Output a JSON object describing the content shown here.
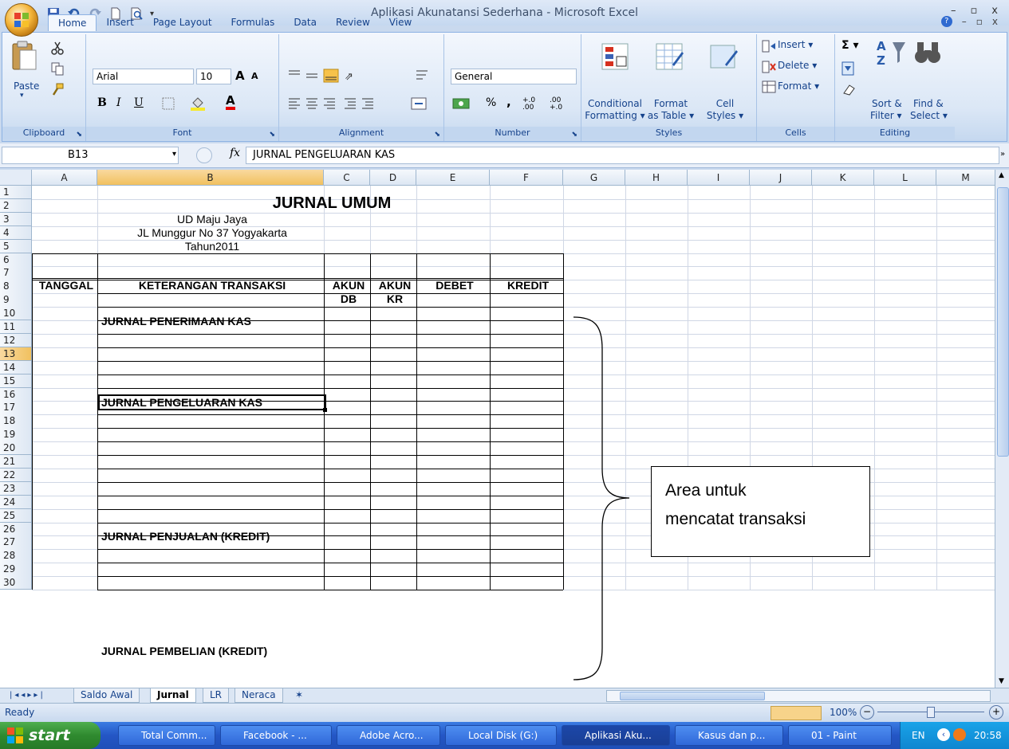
{
  "window": {
    "title": "Aplikasi Akunatansi Sederhana - Microsoft Excel"
  },
  "ribbon": {
    "tabs": [
      "Home",
      "Insert",
      "Page Layout",
      "Formulas",
      "Data",
      "Review",
      "View"
    ],
    "active_tab": "Home",
    "clipboard": {
      "label": "Clipboard",
      "paste": "Paste"
    },
    "font": {
      "label": "Font",
      "name": "Arial",
      "size": "10",
      "bold": "B",
      "italic": "I",
      "underline": "U",
      "grow": "A",
      "shrink": "A",
      "color": "A"
    },
    "alignment": {
      "label": "Alignment"
    },
    "number": {
      "label": "Number",
      "format": "General",
      "percent": "%",
      "comma": ",",
      "inc_decimal": "+.0 .00",
      "dec_decimal": ".00 +.0"
    },
    "styles": {
      "label": "Styles",
      "conditional": [
        "Conditional",
        "Formatting ▾"
      ],
      "format_table": [
        "Format",
        "as Table ▾"
      ],
      "cell_styles": [
        "Cell",
        "Styles ▾"
      ]
    },
    "cells": {
      "label": "Cells",
      "insert": "Insert ▾",
      "delete": "Delete ▾",
      "format": "Format ▾"
    },
    "editing": {
      "label": "Editing",
      "sigma": "Σ ▾",
      "sort": [
        "Sort &",
        "Filter ▾"
      ],
      "find": [
        "Find &",
        "Select ▾"
      ]
    }
  },
  "formula_bar": {
    "name_box": "B13",
    "fx": "fx",
    "content": "JURNAL PENGELUARAN KAS"
  },
  "sheet": {
    "columns": [
      "A",
      "B",
      "C",
      "D",
      "E",
      "F",
      "G",
      "H",
      "I",
      "J",
      "K",
      "L",
      "M"
    ],
    "selected_column": "B",
    "rows": [
      "1",
      "2",
      "3",
      "4",
      "5",
      "6",
      "7",
      "8",
      "9",
      "10",
      "11",
      "12",
      "13",
      "14",
      "15",
      "16",
      "17",
      "18",
      "19",
      "20",
      "21",
      "22",
      "23",
      "24",
      "25",
      "26",
      "27",
      "28",
      "29",
      "30"
    ],
    "selected_row": "13",
    "title": "JURNAL UMUM",
    "company": "UD Maju Jaya",
    "address": "JL Munggur No 37 Yogyakarta",
    "year": "Tahun2011",
    "headers": {
      "tanggal": "TANGGAL",
      "keterangan": "KETERANGAN TRANSAKSI",
      "akun_db": [
        "AKUN",
        "DB"
      ],
      "akun_kr": [
        "AKUN",
        "KR"
      ],
      "debet": "DEBET",
      "kredit": "KREDIT"
    },
    "sections": [
      {
        "row": 8,
        "label": "JURNAL PENERIMAAN KAS"
      },
      {
        "row": 13,
        "label": "JURNAL PENGELUARAN KAS"
      },
      {
        "row": 21,
        "label": "JURNAL PENJUALAN (KREDIT)"
      },
      {
        "row": 28,
        "label": "JURNAL PEMBELIAN (KREDIT)"
      }
    ],
    "callout": [
      "Area untuk",
      "mencatat transaksi"
    ]
  },
  "sheet_tabs": [
    "Saldo Awal",
    "Jurnal",
    "LR",
    "Neraca"
  ],
  "active_sheet": "Jurnal",
  "status": {
    "ready": "Ready",
    "zoom": "100%"
  },
  "taskbar": {
    "start": "start",
    "items": [
      "Total Comm...",
      "Facebook - ...",
      "Adobe Acro...",
      "Local Disk (G:)",
      "Aplikasi Aku...",
      "Kasus dan p...",
      "01 - Paint"
    ],
    "active_item": "Aplikasi Aku...",
    "lang": "EN",
    "clock": "20:58"
  }
}
